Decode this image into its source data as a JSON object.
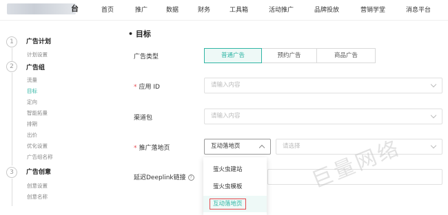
{
  "nav": {
    "brand_tail": "台",
    "items": [
      "首页",
      "推广",
      "数据",
      "财务",
      "工具箱",
      "活动推广",
      "品牌投放",
      "营销学堂",
      "消息平台"
    ]
  },
  "sidebar": {
    "steps": [
      {
        "num": "1",
        "title": "广告计划",
        "subs": [
          "计划设置"
        ]
      },
      {
        "num": "2",
        "title": "广告组",
        "subs": [
          "流量",
          "目标",
          "定向",
          "智能拓量",
          "排期",
          "出价",
          "优化设置",
          "广告组名称"
        ]
      },
      {
        "num": "3",
        "title": "广告创意",
        "subs": [
          "创意设置",
          "创意名称"
        ]
      }
    ],
    "active_sub": "目标"
  },
  "form": {
    "section_title": "• 目标",
    "ad_type": {
      "label": "广告类型",
      "options": [
        "普通广告",
        "预约广告",
        "商品广告"
      ],
      "selected": "普通广告"
    },
    "app_id": {
      "label": "应用 ID",
      "placeholder": "请输入内容"
    },
    "channel_pkg": {
      "label": "渠道包",
      "placeholder": "请输入内容"
    },
    "landing": {
      "label": "推广落地页",
      "value": "互动落地页",
      "placeholder2": "请选择",
      "options": [
        "萤火虫建站",
        "萤火虫模板",
        "互动落地页"
      ]
    },
    "deeplink": {
      "label": "延迟Deeplink链接",
      "help": "?"
    }
  },
  "watermark": "巨量网络",
  "colors": {
    "accent": "#2fb5a4",
    "required": "#e5484d",
    "highlight_box": "#e5484d"
  }
}
